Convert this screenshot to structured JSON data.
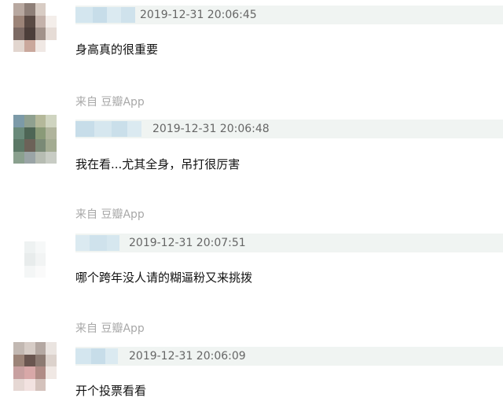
{
  "comments": [
    {
      "timestamp": "2019-12-31 20:06:45",
      "text": "身高真的很重要",
      "avatar_colors": [
        "#b8a8a0",
        "#8e7f78",
        "#d8ccc4",
        "#ffffff",
        "#9c8478",
        "#5a4a44",
        "#c4b2aa",
        "#f4eeea",
        "#7c6a64",
        "#4c3e3a",
        "#a2928a",
        "#e6dcd6",
        "#e2d6cf",
        "#caa89c",
        "#f0e8e4",
        "#ffffff"
      ]
    },
    {
      "timestamp": "2019-12-31 20:06:48",
      "text": "我在看...尤其全身，吊打很厉害",
      "avatar_colors": [
        "#7c9aa8",
        "#8fa090",
        "#b4b89a",
        "#cfd4c0",
        "#6a8a7a",
        "#4e6656",
        "#8a9a78",
        "#b0b49c",
        "#5c7866",
        "#6c6258",
        "#7a8a76",
        "#a4ac92",
        "#8aa08e",
        "#9aa4a6",
        "#b6bcb2",
        "#c8ccc4"
      ]
    },
    {
      "source": "来自 豆瓣App",
      "timestamp": "2019-12-31 20:07:51",
      "text": "哪个跨年没人请的糊逼粉又来挑拨",
      "avatar_colors": [
        "#ffffff",
        "#ffffff",
        "#ffffff",
        "#ffffff",
        "#ffffff",
        "#eef2f2",
        "#f6f8f8",
        "#ffffff",
        "#ffffff",
        "#e8ecec",
        "#f2f4f4",
        "#ffffff",
        "#ffffff",
        "#f4f6f6",
        "#fafafa",
        "#ffffff"
      ]
    },
    {
      "source": "来自 豆瓣App",
      "timestamp": "2019-12-31 20:06:09",
      "text": "开个投票看看",
      "avatar_colors": [
        "#c2b8b2",
        "#d6ccc6",
        "#b4a8a2",
        "#eae4e0",
        "#9c8478",
        "#6a5650",
        "#8c7a72",
        "#dcd2cc",
        "#c8a0a0",
        "#d8a8a8",
        "#b08c86",
        "#f0e8e4",
        "#e6d8d4",
        "#f2e2e0",
        "#d4c2bc",
        "#ffffff"
      ]
    }
  ],
  "leading_source": "来自 豆瓣App",
  "colors": {
    "header_band": "#f0f4f2",
    "name_blur": "#cfe2ec",
    "source_text": "#a8a8a8",
    "timestamp_text": "#666666",
    "comment_text": "#111111"
  }
}
